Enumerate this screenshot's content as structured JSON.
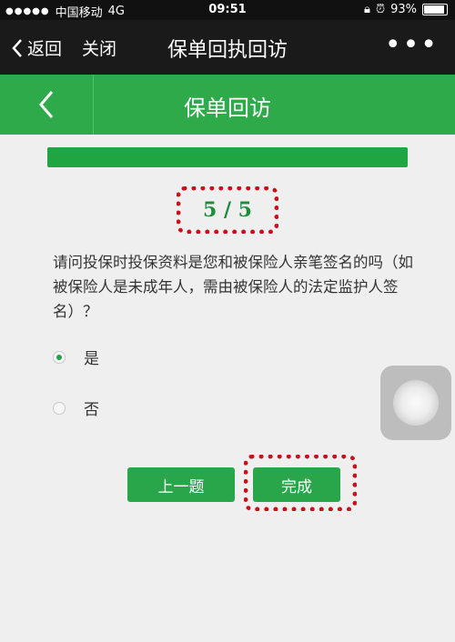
{
  "status_bar": {
    "signal_dots": "●●●●●",
    "carrier": "中国移动",
    "network": "4G",
    "time": "09:51",
    "battery_percent": "93%",
    "battery_level": 0.93
  },
  "nav_bar": {
    "back_label": "返回",
    "close_label": "关闭",
    "title": "保单回执回访",
    "more": "•••"
  },
  "page_header": {
    "back_icon": "chevron-left-icon",
    "title": "保单回访"
  },
  "survey": {
    "progress": 1.0,
    "counter": "5 / 5",
    "question": "请问投保时投保资料是您和被保险人亲笔签名的吗（如被保险人是未成年人，需由被保险人的法定监护人签名）？",
    "options": [
      {
        "label": "是",
        "selected": true
      },
      {
        "label": "否",
        "selected": false
      }
    ],
    "prev_button": "上一题",
    "finish_button": "完成"
  },
  "colors": {
    "accent_green": "#2eaa4a",
    "highlight_red": "#c8111b"
  }
}
